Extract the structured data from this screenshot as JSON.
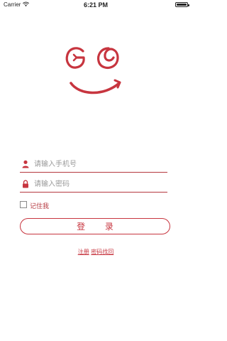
{
  "status_bar": {
    "carrier": "Carrier",
    "time": "6:21 PM",
    "battery_level": 1.0
  },
  "login_form": {
    "phone_placeholder": "请输入手机号",
    "password_placeholder": "请输入密码",
    "remember_label": "记住我",
    "login_button_label": "登 录",
    "register_link": "注册",
    "find_password_link": "密码找回"
  },
  "colors": {
    "brand_red": "#c7353f",
    "field_underline": "#b5383f",
    "background": "#ffffff"
  },
  "icons": {
    "wifi": "wifi-icon",
    "battery": "battery-icon",
    "logo": "go-smile-logo",
    "user": "user-icon",
    "lock": "lock-icon",
    "checkbox": "checkbox-icon"
  }
}
